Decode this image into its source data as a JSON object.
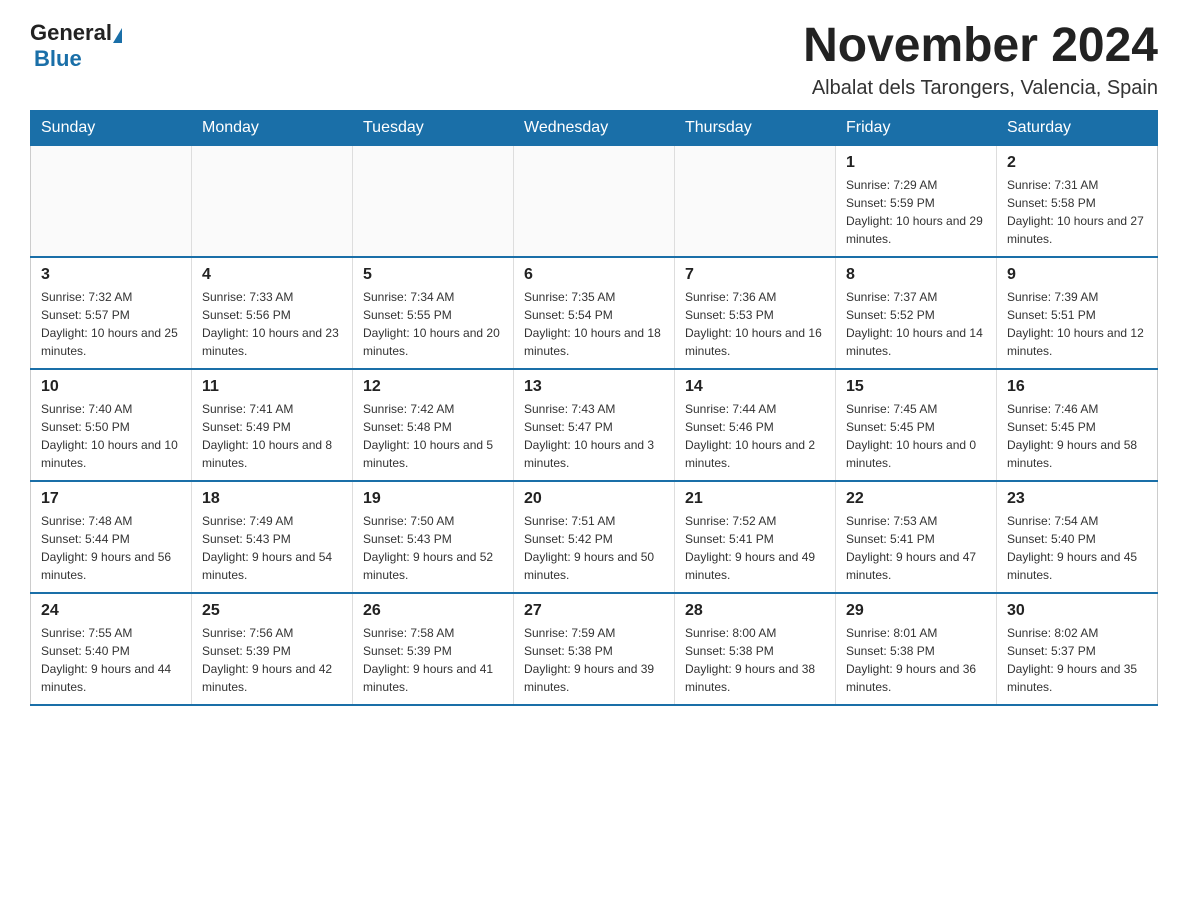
{
  "header": {
    "logo_general": "General",
    "logo_blue": "Blue",
    "month_title": "November 2024",
    "location": "Albalat dels Tarongers, Valencia, Spain"
  },
  "weekdays": [
    "Sunday",
    "Monday",
    "Tuesday",
    "Wednesday",
    "Thursday",
    "Friday",
    "Saturday"
  ],
  "weeks": [
    [
      {
        "day": "",
        "sunrise": "",
        "sunset": "",
        "daylight": ""
      },
      {
        "day": "",
        "sunrise": "",
        "sunset": "",
        "daylight": ""
      },
      {
        "day": "",
        "sunrise": "",
        "sunset": "",
        "daylight": ""
      },
      {
        "day": "",
        "sunrise": "",
        "sunset": "",
        "daylight": ""
      },
      {
        "day": "",
        "sunrise": "",
        "sunset": "",
        "daylight": ""
      },
      {
        "day": "1",
        "sunrise": "Sunrise: 7:29 AM",
        "sunset": "Sunset: 5:59 PM",
        "daylight": "Daylight: 10 hours and 29 minutes."
      },
      {
        "day": "2",
        "sunrise": "Sunrise: 7:31 AM",
        "sunset": "Sunset: 5:58 PM",
        "daylight": "Daylight: 10 hours and 27 minutes."
      }
    ],
    [
      {
        "day": "3",
        "sunrise": "Sunrise: 7:32 AM",
        "sunset": "Sunset: 5:57 PM",
        "daylight": "Daylight: 10 hours and 25 minutes."
      },
      {
        "day": "4",
        "sunrise": "Sunrise: 7:33 AM",
        "sunset": "Sunset: 5:56 PM",
        "daylight": "Daylight: 10 hours and 23 minutes."
      },
      {
        "day": "5",
        "sunrise": "Sunrise: 7:34 AM",
        "sunset": "Sunset: 5:55 PM",
        "daylight": "Daylight: 10 hours and 20 minutes."
      },
      {
        "day": "6",
        "sunrise": "Sunrise: 7:35 AM",
        "sunset": "Sunset: 5:54 PM",
        "daylight": "Daylight: 10 hours and 18 minutes."
      },
      {
        "day": "7",
        "sunrise": "Sunrise: 7:36 AM",
        "sunset": "Sunset: 5:53 PM",
        "daylight": "Daylight: 10 hours and 16 minutes."
      },
      {
        "day": "8",
        "sunrise": "Sunrise: 7:37 AM",
        "sunset": "Sunset: 5:52 PM",
        "daylight": "Daylight: 10 hours and 14 minutes."
      },
      {
        "day": "9",
        "sunrise": "Sunrise: 7:39 AM",
        "sunset": "Sunset: 5:51 PM",
        "daylight": "Daylight: 10 hours and 12 minutes."
      }
    ],
    [
      {
        "day": "10",
        "sunrise": "Sunrise: 7:40 AM",
        "sunset": "Sunset: 5:50 PM",
        "daylight": "Daylight: 10 hours and 10 minutes."
      },
      {
        "day": "11",
        "sunrise": "Sunrise: 7:41 AM",
        "sunset": "Sunset: 5:49 PM",
        "daylight": "Daylight: 10 hours and 8 minutes."
      },
      {
        "day": "12",
        "sunrise": "Sunrise: 7:42 AM",
        "sunset": "Sunset: 5:48 PM",
        "daylight": "Daylight: 10 hours and 5 minutes."
      },
      {
        "day": "13",
        "sunrise": "Sunrise: 7:43 AM",
        "sunset": "Sunset: 5:47 PM",
        "daylight": "Daylight: 10 hours and 3 minutes."
      },
      {
        "day": "14",
        "sunrise": "Sunrise: 7:44 AM",
        "sunset": "Sunset: 5:46 PM",
        "daylight": "Daylight: 10 hours and 2 minutes."
      },
      {
        "day": "15",
        "sunrise": "Sunrise: 7:45 AM",
        "sunset": "Sunset: 5:45 PM",
        "daylight": "Daylight: 10 hours and 0 minutes."
      },
      {
        "day": "16",
        "sunrise": "Sunrise: 7:46 AM",
        "sunset": "Sunset: 5:45 PM",
        "daylight": "Daylight: 9 hours and 58 minutes."
      }
    ],
    [
      {
        "day": "17",
        "sunrise": "Sunrise: 7:48 AM",
        "sunset": "Sunset: 5:44 PM",
        "daylight": "Daylight: 9 hours and 56 minutes."
      },
      {
        "day": "18",
        "sunrise": "Sunrise: 7:49 AM",
        "sunset": "Sunset: 5:43 PM",
        "daylight": "Daylight: 9 hours and 54 minutes."
      },
      {
        "day": "19",
        "sunrise": "Sunrise: 7:50 AM",
        "sunset": "Sunset: 5:43 PM",
        "daylight": "Daylight: 9 hours and 52 minutes."
      },
      {
        "day": "20",
        "sunrise": "Sunrise: 7:51 AM",
        "sunset": "Sunset: 5:42 PM",
        "daylight": "Daylight: 9 hours and 50 minutes."
      },
      {
        "day": "21",
        "sunrise": "Sunrise: 7:52 AM",
        "sunset": "Sunset: 5:41 PM",
        "daylight": "Daylight: 9 hours and 49 minutes."
      },
      {
        "day": "22",
        "sunrise": "Sunrise: 7:53 AM",
        "sunset": "Sunset: 5:41 PM",
        "daylight": "Daylight: 9 hours and 47 minutes."
      },
      {
        "day": "23",
        "sunrise": "Sunrise: 7:54 AM",
        "sunset": "Sunset: 5:40 PM",
        "daylight": "Daylight: 9 hours and 45 minutes."
      }
    ],
    [
      {
        "day": "24",
        "sunrise": "Sunrise: 7:55 AM",
        "sunset": "Sunset: 5:40 PM",
        "daylight": "Daylight: 9 hours and 44 minutes."
      },
      {
        "day": "25",
        "sunrise": "Sunrise: 7:56 AM",
        "sunset": "Sunset: 5:39 PM",
        "daylight": "Daylight: 9 hours and 42 minutes."
      },
      {
        "day": "26",
        "sunrise": "Sunrise: 7:58 AM",
        "sunset": "Sunset: 5:39 PM",
        "daylight": "Daylight: 9 hours and 41 minutes."
      },
      {
        "day": "27",
        "sunrise": "Sunrise: 7:59 AM",
        "sunset": "Sunset: 5:38 PM",
        "daylight": "Daylight: 9 hours and 39 minutes."
      },
      {
        "day": "28",
        "sunrise": "Sunrise: 8:00 AM",
        "sunset": "Sunset: 5:38 PM",
        "daylight": "Daylight: 9 hours and 38 minutes."
      },
      {
        "day": "29",
        "sunrise": "Sunrise: 8:01 AM",
        "sunset": "Sunset: 5:38 PM",
        "daylight": "Daylight: 9 hours and 36 minutes."
      },
      {
        "day": "30",
        "sunrise": "Sunrise: 8:02 AM",
        "sunset": "Sunset: 5:37 PM",
        "daylight": "Daylight: 9 hours and 35 minutes."
      }
    ]
  ]
}
